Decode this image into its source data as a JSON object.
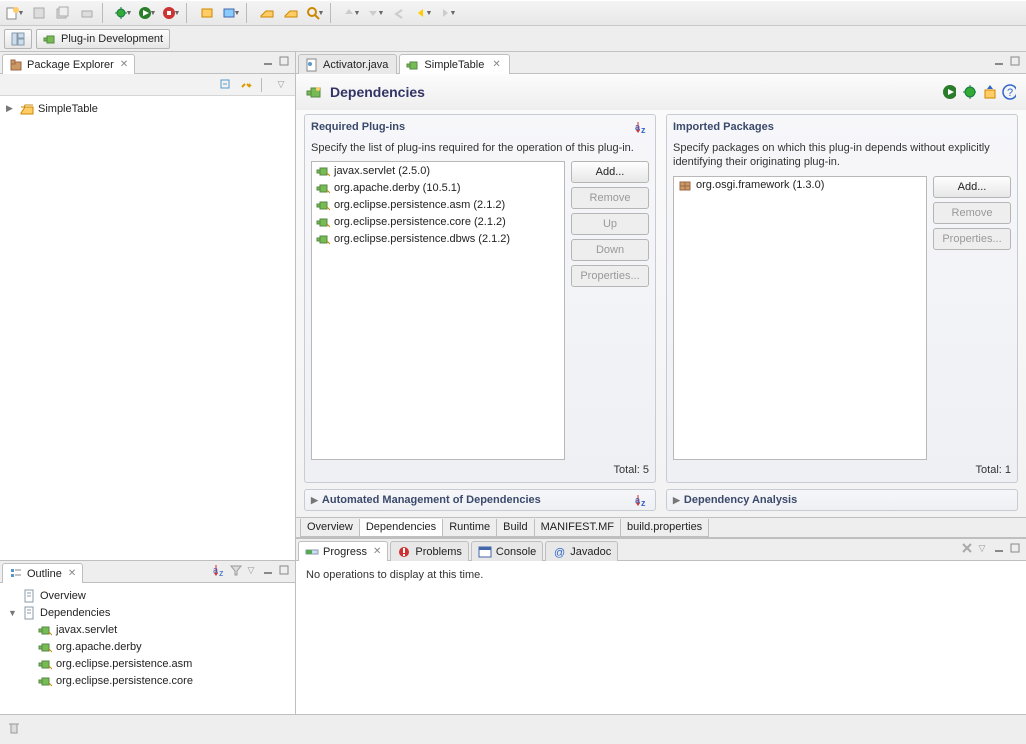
{
  "perspective": {
    "label": "Plug-in Development"
  },
  "packageExplorer": {
    "title": "Package Explorer",
    "project": "SimpleTable"
  },
  "outline": {
    "title": "Outline",
    "items": [
      {
        "label": "Overview",
        "indent": 0,
        "twisty": ""
      },
      {
        "label": "Dependencies",
        "indent": 0,
        "twisty": "▼"
      },
      {
        "label": "javax.servlet",
        "indent": 1,
        "twisty": ""
      },
      {
        "label": "org.apache.derby",
        "indent": 1,
        "twisty": ""
      },
      {
        "label": "org.eclipse.persistence.asm",
        "indent": 1,
        "twisty": ""
      },
      {
        "label": "org.eclipse.persistence.core",
        "indent": 1,
        "twisty": ""
      }
    ]
  },
  "editorTabs": {
    "tab1": "Activator.java",
    "tab2": "SimpleTable"
  },
  "form": {
    "title": "Dependencies",
    "required": {
      "title": "Required Plug-ins",
      "desc": "Specify the list of plug-ins required for the operation of this plug-in.",
      "items": [
        "javax.servlet (2.5.0)",
        "org.apache.derby (10.5.1)",
        "org.eclipse.persistence.asm (2.1.2)",
        "org.eclipse.persistence.core (2.1.2)",
        "org.eclipse.persistence.dbws (2.1.2)"
      ],
      "total": "Total: 5",
      "buttons": {
        "add": "Add...",
        "remove": "Remove",
        "up": "Up",
        "down": "Down",
        "props": "Properties..."
      }
    },
    "imported": {
      "title": "Imported Packages",
      "desc": "Specify packages on which this plug-in depends without explicitly identifying their originating plug-in.",
      "items": [
        "org.osgi.framework (1.3.0)"
      ],
      "total": "Total: 1",
      "buttons": {
        "add": "Add...",
        "remove": "Remove",
        "props": "Properties..."
      }
    },
    "automated": "Automated Management of Dependencies",
    "analysis": "Dependency Analysis"
  },
  "editorBottomTabs": [
    "Overview",
    "Dependencies",
    "Runtime",
    "Build",
    "MANIFEST.MF",
    "build.properties"
  ],
  "lowerTabs": {
    "progress": "Progress",
    "problems": "Problems",
    "console": "Console",
    "javadoc": "Javadoc"
  },
  "progressBody": "No operations to display at this time.",
  "icons": {
    "run": "▶",
    "debug": "🐞",
    "help": "?"
  }
}
